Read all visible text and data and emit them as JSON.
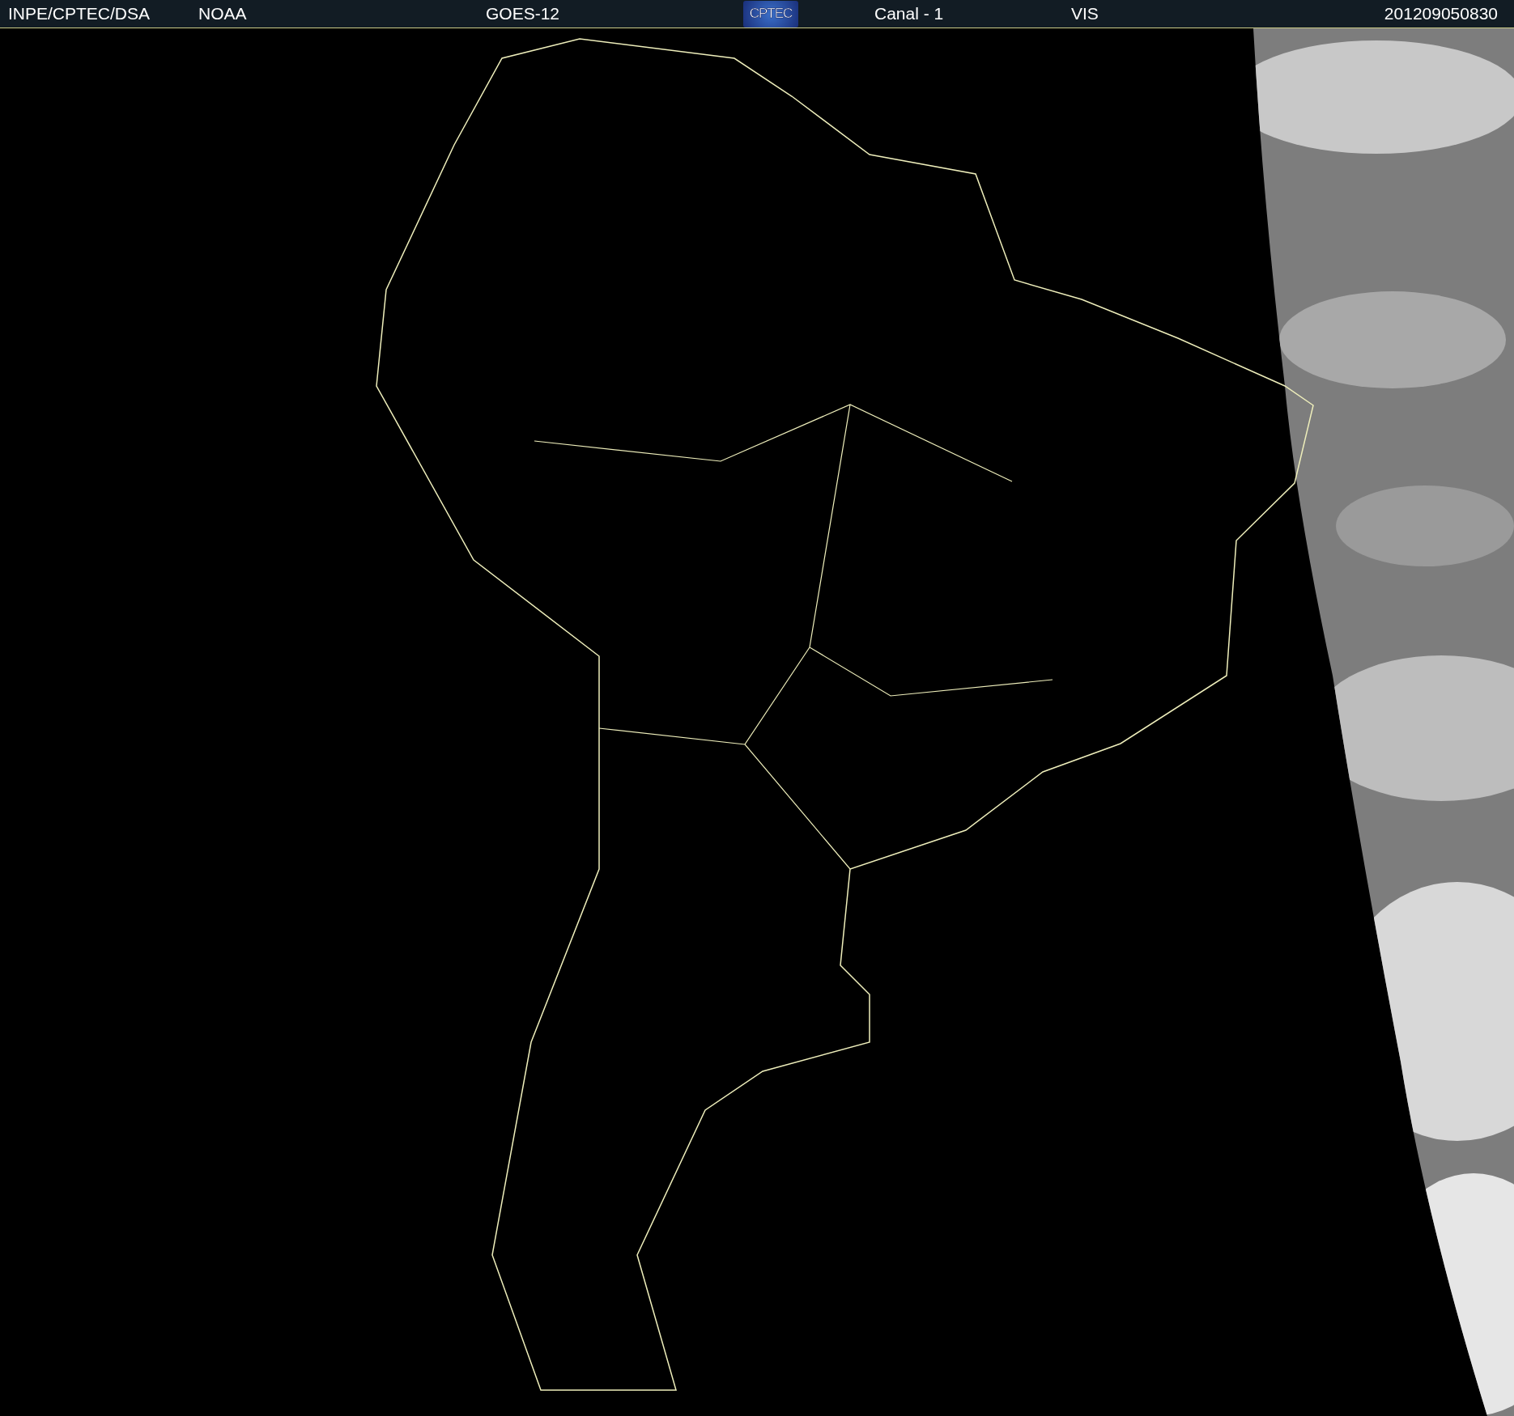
{
  "header": {
    "items": [
      {
        "kind": "text",
        "text": "INPE/CPTEC/DSA"
      },
      {
        "kind": "text",
        "text": "NOAA"
      },
      {
        "kind": "text",
        "text": "GOES-12"
      },
      {
        "kind": "logo",
        "text": "CPTEC"
      },
      {
        "kind": "text",
        "text": "Canal - 1"
      },
      {
        "kind": "text",
        "text": "VIS"
      },
      {
        "kind": "text",
        "text": "201209050830"
      }
    ]
  }
}
